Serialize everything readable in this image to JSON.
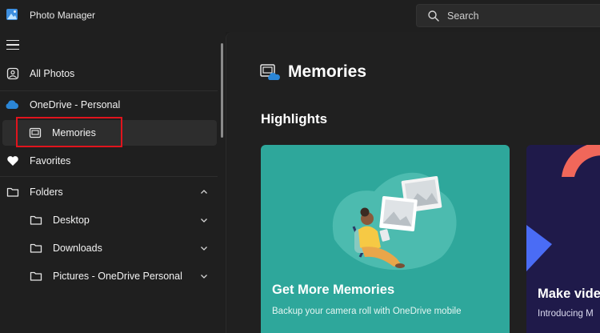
{
  "app": {
    "title": "Photo Manager"
  },
  "search": {
    "placeholder": "Search"
  },
  "sidebar": {
    "items": [
      {
        "label": "All Photos",
        "icon": "photos-icon"
      },
      {
        "label": "OneDrive - Personal",
        "icon": "cloud-icon"
      },
      {
        "label": "Memories",
        "icon": "memories-icon",
        "selected": true
      },
      {
        "label": "Favorites",
        "icon": "heart-icon"
      },
      {
        "label": "Folders",
        "icon": "folder-icon",
        "expanded": true
      },
      {
        "label": "Desktop",
        "icon": "folder-icon"
      },
      {
        "label": "Downloads",
        "icon": "folder-icon"
      },
      {
        "label": "Pictures - OneDrive Personal",
        "icon": "folder-icon"
      }
    ]
  },
  "main": {
    "title": "Memories",
    "section": "Highlights",
    "cards": [
      {
        "title": "Get More Memories",
        "subtitle": "Backup your camera roll with OneDrive mobile"
      },
      {
        "title": "Make vide",
        "subtitle": "Introducing M"
      }
    ]
  },
  "colors": {
    "accent_card1": "#2ea79b",
    "accent_card2": "#1f1a4a",
    "highlight_border": "#e0141d",
    "cloud_blue": "#2b86d6",
    "card2_coral": "#f0675a",
    "card2_blue": "#4a6cf5"
  }
}
